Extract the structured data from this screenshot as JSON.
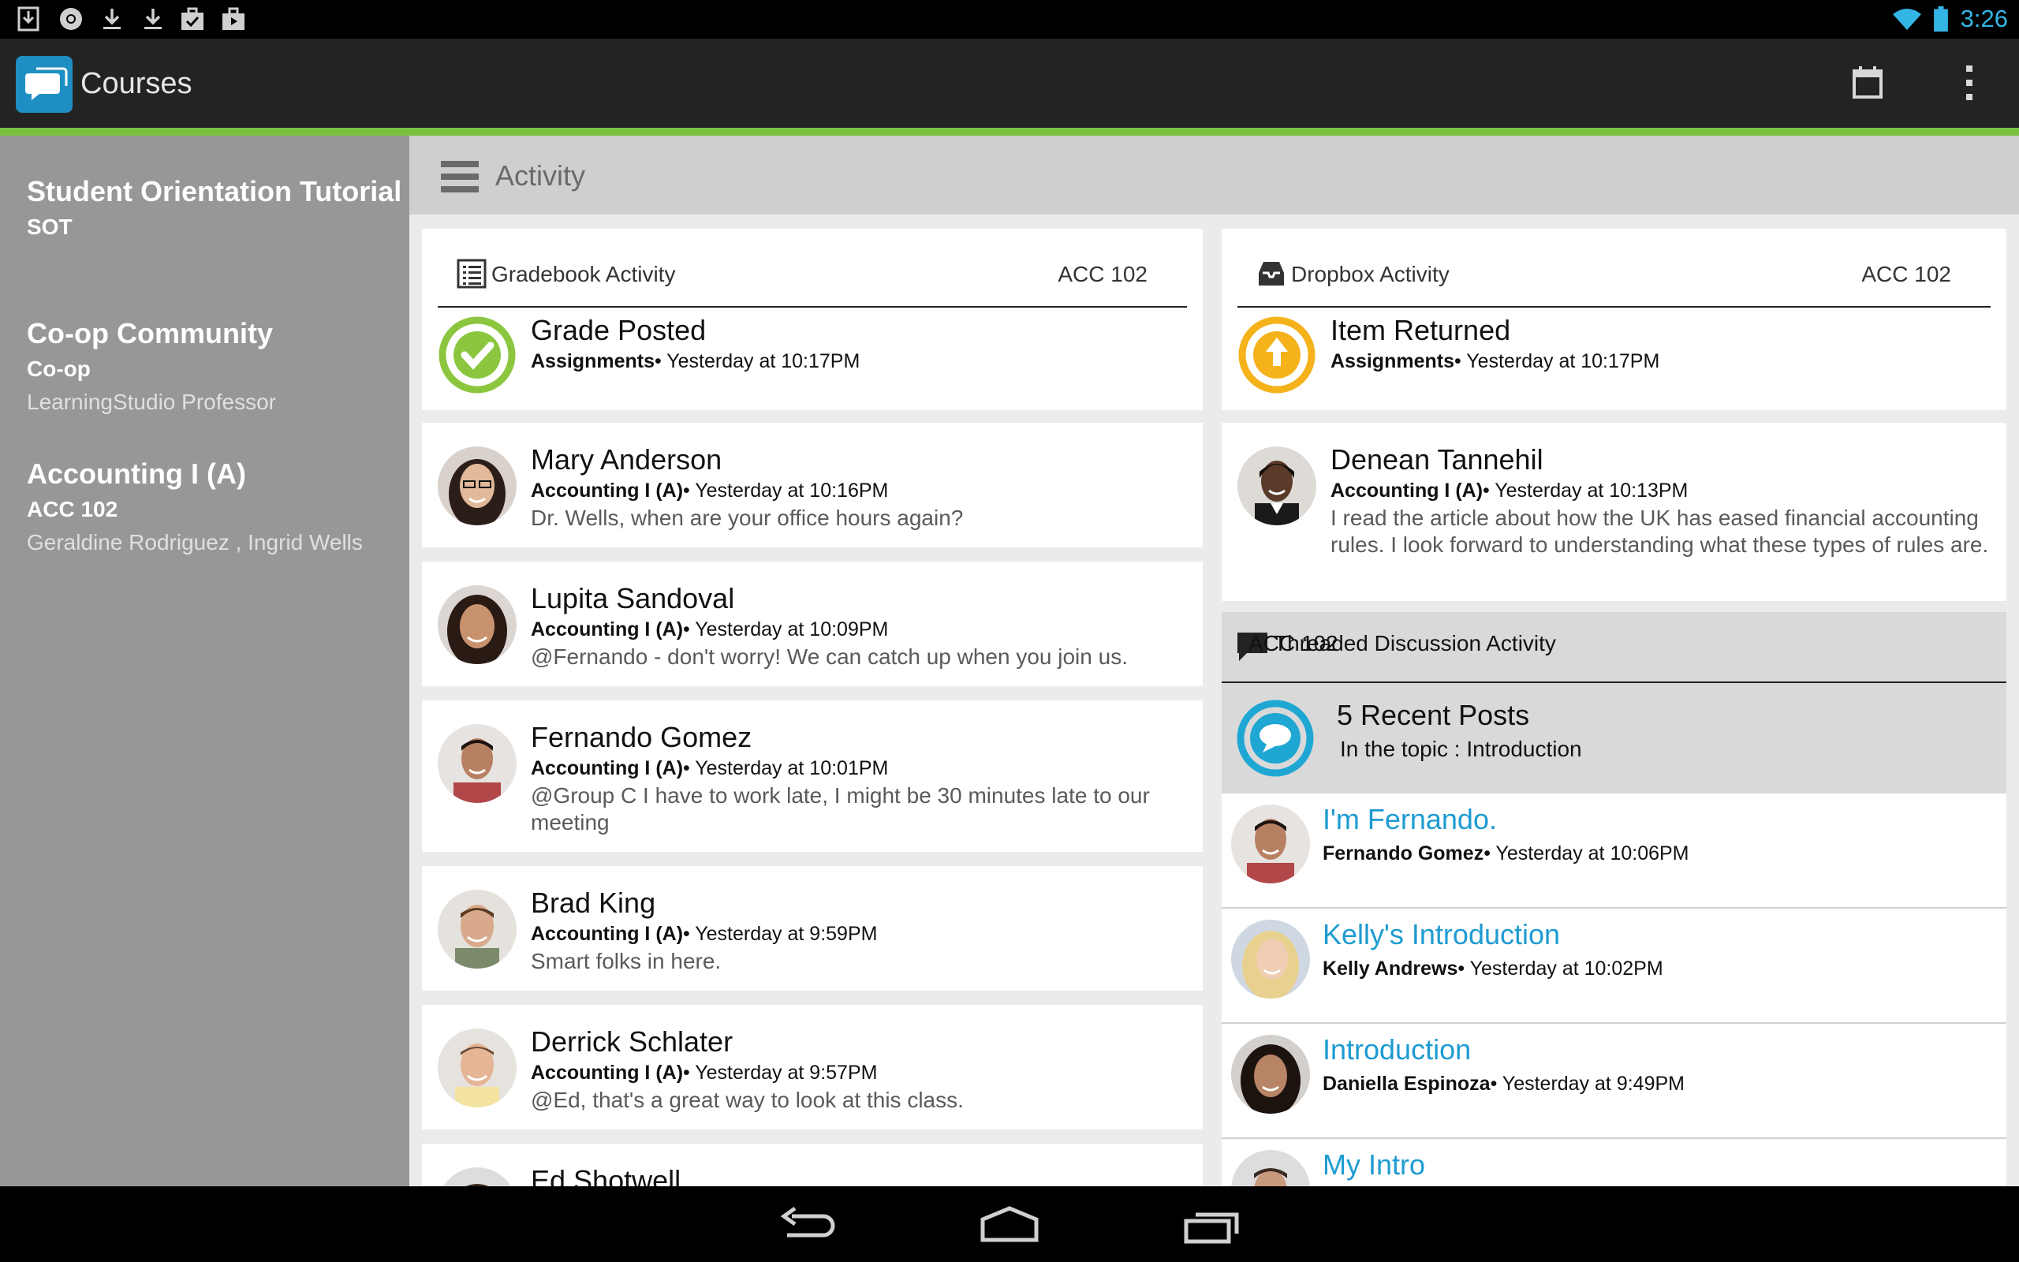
{
  "status_bar": {
    "time": "3:26",
    "icons": [
      "download-box-icon",
      "chrome-icon",
      "download-icon",
      "download-icon",
      "briefcase-check-icon",
      "shopping-bag-icon",
      "wifi-icon",
      "battery-icon"
    ]
  },
  "action_bar": {
    "title": "Courses",
    "icons": [
      "chat-bubbles-icon",
      "calendar-icon",
      "overflow-menu-icon"
    ]
  },
  "colors": {
    "accent": "#7ac142",
    "link": "#1e9bd1",
    "app_icon": "#1f8ec3",
    "check": "#8cc63f",
    "upload": "#f5b21b",
    "discussion": "#1fa7d3"
  },
  "sidebar": {
    "courses": [
      {
        "name": "Student Orientation Tutorial",
        "code": "SOT",
        "professors": ""
      },
      {
        "name": "Co-op Community",
        "code": "Co-op",
        "professors": "LearningStudio Professor"
      },
      {
        "name": "Accounting I (A)",
        "code": "ACC 102",
        "professors": "Geraldine Rodriguez , Ingrid Wells"
      }
    ]
  },
  "main": {
    "title": "Activity",
    "gradebook": {
      "title": "Gradebook Activity",
      "course": "ACC 102",
      "item": {
        "title": "Grade Posted",
        "source": "Assignments",
        "time": "• Yesterday at 10:17PM"
      }
    },
    "dropbox": {
      "title": "Dropbox Activity",
      "course": "ACC 102",
      "item": {
        "title": "Item Returned",
        "source": "Assignments",
        "time": "• Yesterday at 10:17PM"
      }
    },
    "messages": [
      {
        "name": "Mary Anderson",
        "course": "Accounting I (A)",
        "time": "• Yesterday at 10:16PM",
        "text": "Dr. Wells, when are your office hours again?"
      },
      {
        "name": "Lupita Sandoval",
        "course": "Accounting I (A)",
        "time": "• Yesterday at 10:09PM",
        "text": "@Fernando - don't worry! We can catch up when you join us."
      },
      {
        "name": "Fernando Gomez",
        "course": "Accounting I (A)",
        "time": "• Yesterday at 10:01PM",
        "text": "@Group C I have to work late, I might be 30 minutes late to our meeting"
      },
      {
        "name": "Brad King",
        "course": "Accounting I (A)",
        "time": "• Yesterday at 9:59PM",
        "text": "Smart folks in here."
      },
      {
        "name": "Derrick Schlater",
        "course": "Accounting I (A)",
        "time": "• Yesterday at 9:57PM",
        "text": "@Ed, that's a great way to look at this class."
      },
      {
        "name": "Ed Shotwell",
        "course": "",
        "time": "",
        "text": ""
      }
    ],
    "right_message": {
      "name": "Denean Tannehil",
      "course": "Accounting I (A)",
      "time": "• Yesterday at 10:13PM",
      "text": "I read the article about how the UK has eased financial accounting rules. I look forward to understanding what these types of rules are."
    },
    "threaded": {
      "title": "Threaded Discussion Activity",
      "course": "ACC 102",
      "recent_count": "5 Recent Posts",
      "topic": "In the topic : Introduction",
      "posts": [
        {
          "title": "I'm Fernando.",
          "author": "Fernando Gomez",
          "time": "• Yesterday at 10:06PM"
        },
        {
          "title": "Kelly's Introduction",
          "author": "Kelly Andrews",
          "time": "• Yesterday at 10:02PM"
        },
        {
          "title": "Introduction",
          "author": "Daniella Espinoza",
          "time": "• Yesterday at 9:49PM"
        },
        {
          "title": "My Intro",
          "author": "",
          "time": ""
        }
      ]
    }
  },
  "nav_bar": {
    "icons": [
      "back-icon",
      "home-icon",
      "recent-apps-icon"
    ]
  }
}
